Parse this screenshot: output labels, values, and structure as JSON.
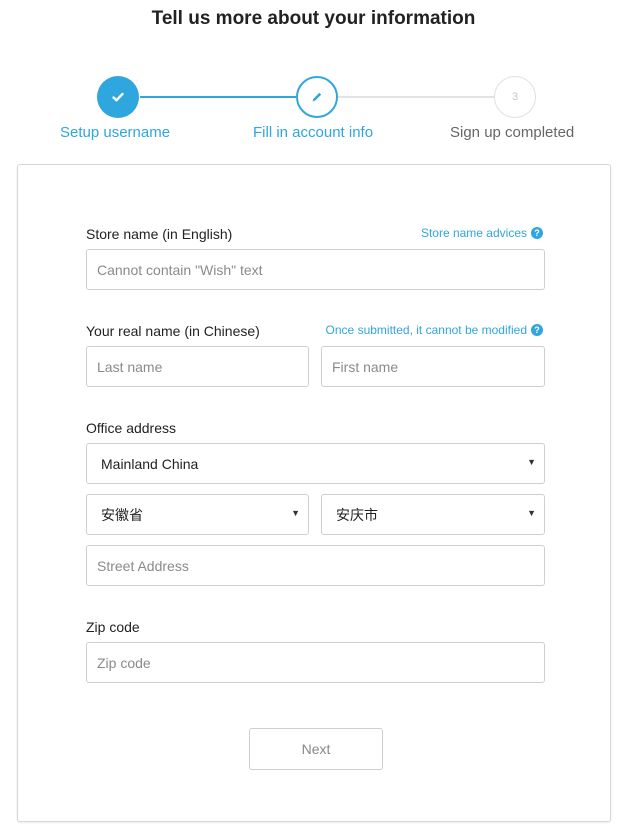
{
  "page": {
    "title": "Tell us more about your information"
  },
  "stepper": {
    "steps": [
      {
        "label": "Setup username",
        "status": "completed",
        "icon": "check-icon"
      },
      {
        "label": "Fill in account info",
        "status": "active",
        "icon": "pencil-icon"
      },
      {
        "label": "Sign up completed",
        "status": "pending",
        "number": "3"
      }
    ],
    "accent_color": "#2fa6de"
  },
  "form": {
    "store_name": {
      "label": "Store name (in English)",
      "hint": "Store name advices",
      "placeholder": "Cannot contain \"Wish\" text",
      "value": ""
    },
    "real_name": {
      "label": "Your real name (in Chinese)",
      "hint": "Once submitted, it cannot be modified",
      "last_placeholder": "Last name",
      "first_placeholder": "First name"
    },
    "office_address": {
      "label": "Office address",
      "country": "Mainland China",
      "province": "安徽省",
      "city": "安庆市",
      "street_placeholder": "Street Address"
    },
    "zip": {
      "label": "Zip code",
      "placeholder": "Zip code"
    },
    "next_label": "Next"
  }
}
